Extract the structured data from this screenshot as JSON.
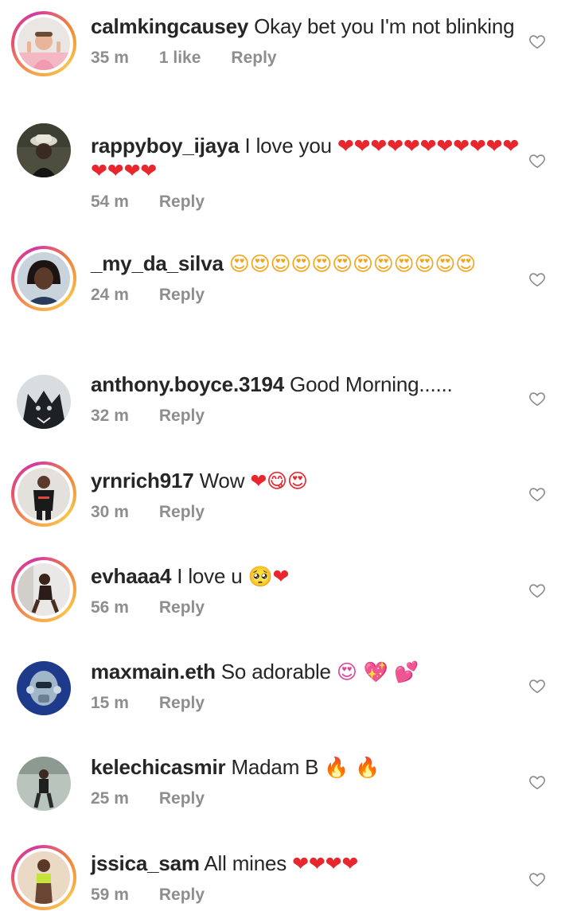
{
  "icons": {
    "like": "heart-outline-icon"
  },
  "comments": [
    {
      "username": "calmkingcausey",
      "text": "Okay bet you I'm not blinking",
      "emojis": "",
      "time": "35 m",
      "likes": "1 like",
      "reply": "Reply",
      "story": true,
      "avatar": "person-in-pink-shirt"
    },
    {
      "username": "rappyboy_ijaya",
      "text": "I love you",
      "emojis": "❤❤❤❤❤❤❤❤❤❤❤❤❤❤❤",
      "time": "54 m",
      "likes": "",
      "reply": "Reply",
      "story": false,
      "avatar": "person-with-bucket-hat"
    },
    {
      "username": "_my_da_silva",
      "text": "",
      "emojis": "😍😍😍😍😍😍😍😍😍😍😍😍",
      "time": "24 m",
      "likes": "",
      "reply": "Reply",
      "story": true,
      "avatar": "smiling-woman"
    },
    {
      "username": "anthony.boyce.3194",
      "text": "Good Morning......",
      "emojis": "",
      "time": "32 m",
      "likes": "",
      "reply": "Reply",
      "story": false,
      "avatar": "black-wolf"
    },
    {
      "username": "yrnrich917",
      "text": "Wow",
      "emojis": "❤😋😍",
      "time": "30 m",
      "likes": "",
      "reply": "Reply",
      "story": true,
      "avatar": "man-in-black-outfit"
    },
    {
      "username": "evhaaa4",
      "text": "I love u",
      "emojis": "🥺❤",
      "time": "56 m",
      "likes": "",
      "reply": "Reply",
      "story": true,
      "avatar": "woman-posing"
    },
    {
      "username": "maxmain.eth",
      "text": "So adorable",
      "emojis": "😍 💖 💕",
      "time": "15 m",
      "likes": "",
      "reply": "Reply",
      "story": false,
      "avatar": "robot-head"
    },
    {
      "username": "kelechicasmir",
      "text": "Madam B",
      "emojis": "🔥 🔥",
      "time": "25 m",
      "likes": "",
      "reply": "Reply",
      "story": false,
      "avatar": "man-walking"
    },
    {
      "username": "jssica_sam",
      "text": "All mines",
      "emojis": "❤❤❤❤",
      "time": "59 m",
      "likes": "",
      "reply": "Reply",
      "story": true,
      "avatar": "woman-in-yellow"
    }
  ]
}
